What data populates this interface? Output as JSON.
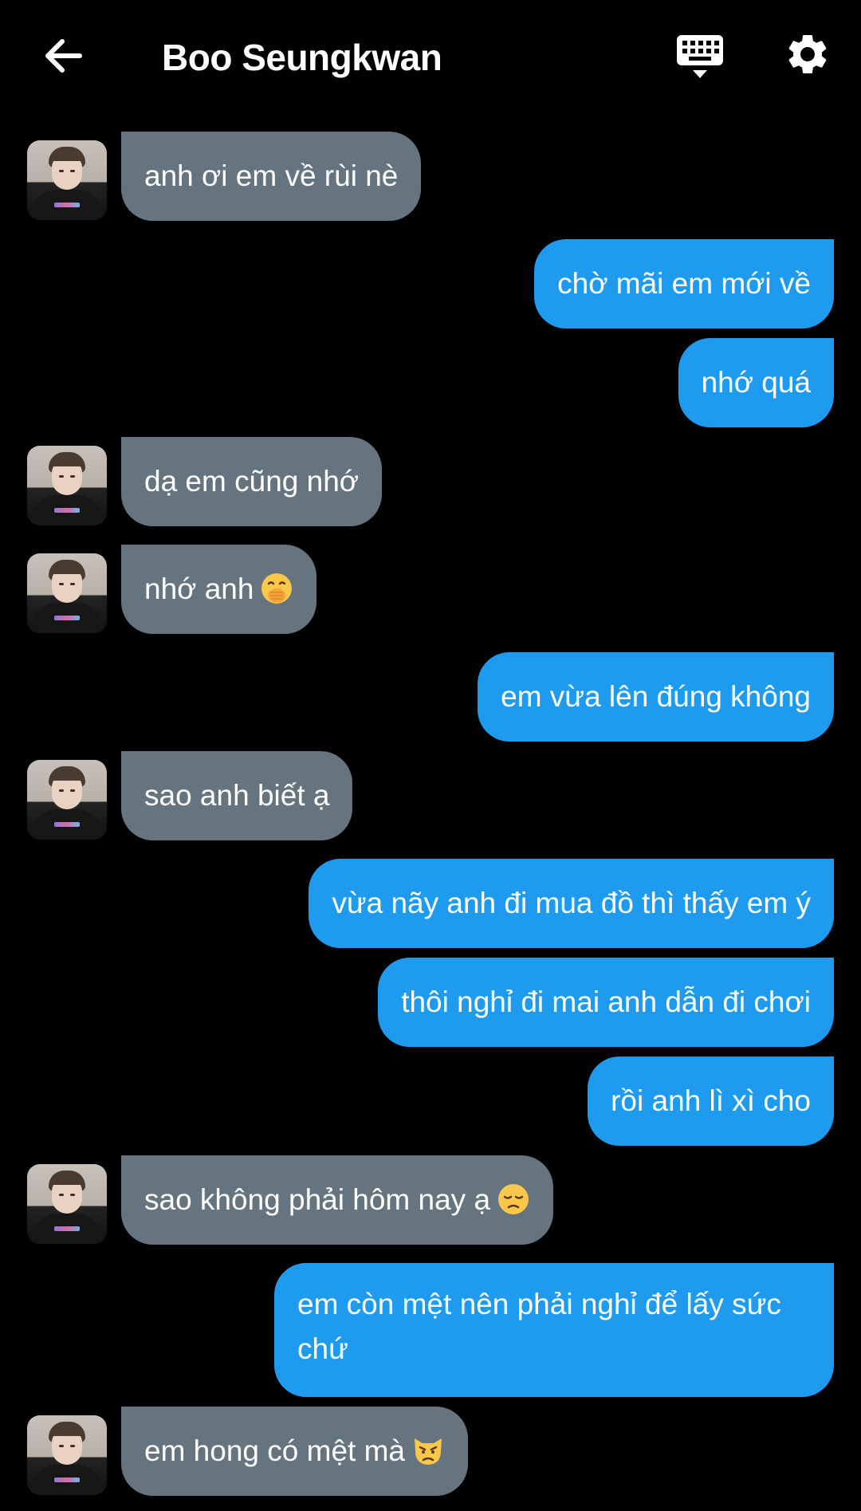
{
  "header": {
    "title": "Boo Seungkwan",
    "back_icon": "arrow-left-icon",
    "keyboard_icon": "keyboard-hide-icon",
    "settings_icon": "gear-icon"
  },
  "colors": {
    "background": "#000000",
    "incoming_bubble": "#667480",
    "outgoing_bubble": "#1e9bef"
  },
  "messages": [
    {
      "side": "in",
      "text": "anh ơi em về rùi nè"
    },
    {
      "side": "out",
      "text": "chờ mãi em mới về"
    },
    {
      "side": "out",
      "text": "nhớ quá"
    },
    {
      "side": "in",
      "text": "dạ em cũng nhớ"
    },
    {
      "side": "in",
      "text": "nhớ anh",
      "emoji": "hand-over-mouth-emoji"
    },
    {
      "side": "out",
      "text": "em vừa lên đúng không"
    },
    {
      "side": "in",
      "text": "sao anh biết ạ"
    },
    {
      "side": "out",
      "text": "vừa nãy anh đi mua đồ thì thấy em ý"
    },
    {
      "side": "out",
      "text": "thôi nghỉ đi mai anh dẫn đi chơi"
    },
    {
      "side": "out",
      "text": "rồi anh lì xì cho"
    },
    {
      "side": "in",
      "text": "sao không phải hôm nay ạ",
      "emoji": "pensive-face-emoji"
    },
    {
      "side": "out",
      "text": "em còn mệt nên phải nghỉ để lấy sức chứ"
    },
    {
      "side": "in",
      "text": "em hong có mệt mà",
      "emoji": "pouting-cat-emoji"
    }
  ]
}
